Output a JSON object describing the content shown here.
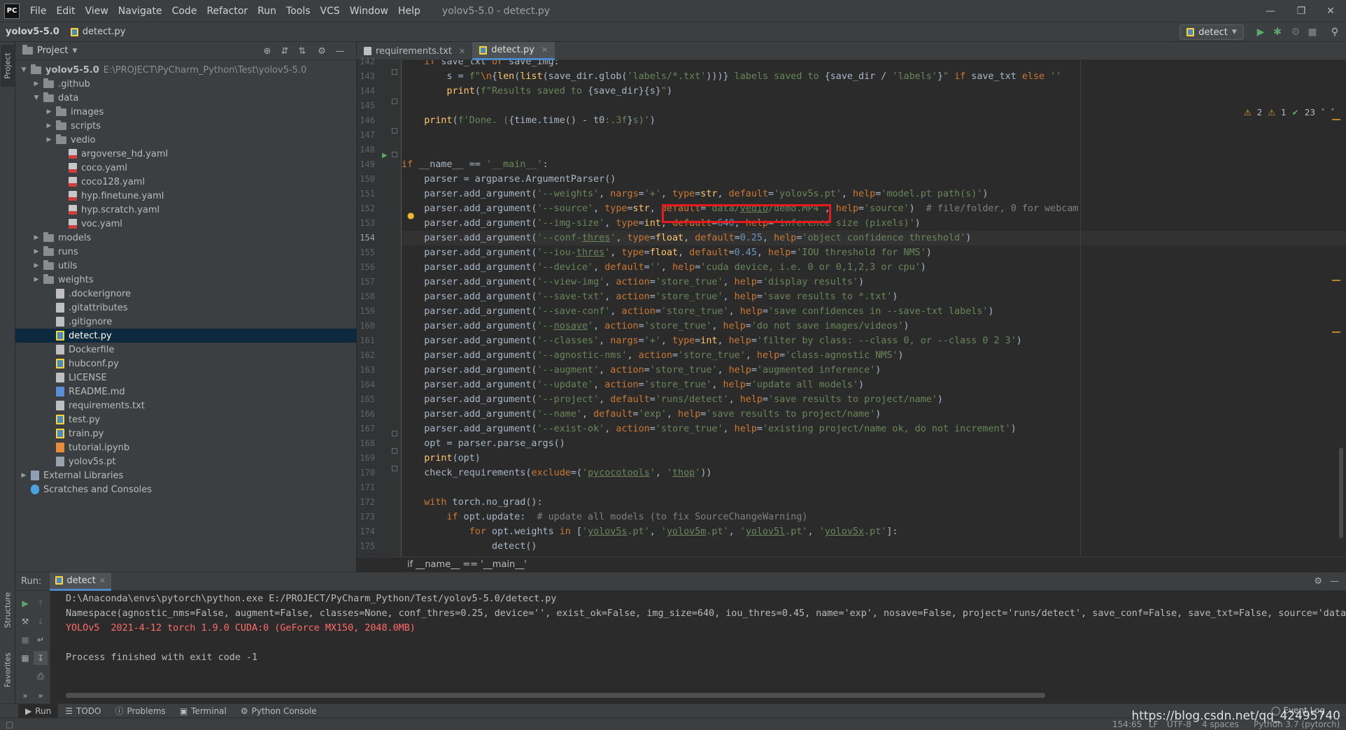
{
  "menubar": {
    "logo": "PC",
    "items": [
      "File",
      "Edit",
      "View",
      "Navigate",
      "Code",
      "Refactor",
      "Run",
      "Tools",
      "VCS",
      "Window",
      "Help"
    ],
    "title": "yolov5-5.0 - detect.py"
  },
  "navbar": {
    "project": "yolov5-5.0",
    "file": "detect.py",
    "run_config": "detect"
  },
  "project_panel": {
    "title": "Project",
    "tree": [
      {
        "label": "yolov5-5.0",
        "extra": "E:\\PROJECT\\PyCharm_Python\\Test\\yolov5-5.0",
        "bold": true,
        "depth": 0,
        "kind": "folder",
        "expanded": true
      },
      {
        "label": ".github",
        "depth": 1,
        "kind": "folder",
        "expanded": false
      },
      {
        "label": "data",
        "depth": 1,
        "kind": "folder",
        "expanded": true
      },
      {
        "label": "images",
        "depth": 2,
        "kind": "folder",
        "expanded": false
      },
      {
        "label": "scripts",
        "depth": 2,
        "kind": "folder",
        "expanded": false
      },
      {
        "label": "vedio",
        "depth": 2,
        "kind": "folder",
        "expanded": false
      },
      {
        "label": "argoverse_hd.yaml",
        "depth": 3,
        "kind": "yaml"
      },
      {
        "label": "coco.yaml",
        "depth": 3,
        "kind": "yaml"
      },
      {
        "label": "coco128.yaml",
        "depth": 3,
        "kind": "yaml"
      },
      {
        "label": "hyp.finetune.yaml",
        "depth": 3,
        "kind": "yaml"
      },
      {
        "label": "hyp.scratch.yaml",
        "depth": 3,
        "kind": "yaml"
      },
      {
        "label": "voc.yaml",
        "depth": 3,
        "kind": "yaml"
      },
      {
        "label": "models",
        "depth": 1,
        "kind": "folder",
        "expanded": false
      },
      {
        "label": "runs",
        "depth": 1,
        "kind": "folder",
        "expanded": false
      },
      {
        "label": "utils",
        "depth": 1,
        "kind": "folder",
        "expanded": false
      },
      {
        "label": "weights",
        "depth": 1,
        "kind": "folder",
        "expanded": false
      },
      {
        "label": ".dockerignore",
        "depth": 2,
        "kind": "txt"
      },
      {
        "label": ".gitattributes",
        "depth": 2,
        "kind": "txt"
      },
      {
        "label": ".gitignore",
        "depth": 2,
        "kind": "txt"
      },
      {
        "label": "detect.py",
        "depth": 2,
        "kind": "py",
        "selected": true
      },
      {
        "label": "Dockerfile",
        "depth": 2,
        "kind": "txt"
      },
      {
        "label": "hubconf.py",
        "depth": 2,
        "kind": "py"
      },
      {
        "label": "LICENSE",
        "depth": 2,
        "kind": "txt"
      },
      {
        "label": "README.md",
        "depth": 2,
        "kind": "md"
      },
      {
        "label": "requirements.txt",
        "depth": 2,
        "kind": "txt"
      },
      {
        "label": "test.py",
        "depth": 2,
        "kind": "py"
      },
      {
        "label": "train.py",
        "depth": 2,
        "kind": "py"
      },
      {
        "label": "tutorial.ipynb",
        "depth": 2,
        "kind": "nb"
      },
      {
        "label": "yolov5s.pt",
        "depth": 2,
        "kind": "pt"
      },
      {
        "label": "External Libraries",
        "depth": 0,
        "kind": "lib",
        "expanded": false
      },
      {
        "label": "Scratches and Consoles",
        "depth": 0,
        "kind": "scratch"
      }
    ]
  },
  "editor": {
    "tabs": [
      {
        "label": "requirements.txt",
        "active": false
      },
      {
        "label": "detect.py",
        "active": true
      }
    ],
    "inspections": {
      "warnings": "2",
      "weak": "1",
      "ok": "23"
    },
    "current_line": 154,
    "lines": [
      {
        "n": 142,
        "h": "    <span class=\"kw\">if</span> save_txt <span class=\"kw\">or</span> save_img:"
      },
      {
        "n": 143,
        "h": "        s = <span class=\"st\">f\"</span><span class=\"kw\">\\n</span>{<span class=\"fn\">len</span>(<span class=\"fn\">list</span>(save_dir.glob(<span class=\"st\">'labels/*.txt'</span>)))}<span class=\"st\"> labels saved to </span>{save_dir / <span class=\"st\">'labels'</span>}<span class=\"st\">\"</span> <span class=\"kw\">if</span> save_txt <span class=\"kw\">else</span> <span class=\"st\">''</span>"
      },
      {
        "n": 144,
        "h": "        <span class=\"fn\">print</span>(<span class=\"st\">f\"Results saved to </span>{save_dir}{s}<span class=\"st\">\"</span>)"
      },
      {
        "n": 145,
        "h": ""
      },
      {
        "n": 146,
        "h": "    <span class=\"fn\">print</span>(<span class=\"st\">f'Done. (</span>{time.time() - t0<span class=\"st\">:.3f</span>}<span class=\"st\">s)'</span>)"
      },
      {
        "n": 147,
        "h": ""
      },
      {
        "n": 148,
        "h": ""
      },
      {
        "n": 149,
        "h": "<span class=\"kw\">if</span> __name__ == <span class=\"st\">'__main__'</span>:"
      },
      {
        "n": 150,
        "h": "    parser = argparse.ArgumentParser()"
      },
      {
        "n": 151,
        "h": "    parser.add_argument(<span class=\"st\">'--weights'</span>, <span class=\"kw\">nargs</span>=<span class=\"st\">'+'</span>, <span class=\"kw\">type</span>=<span class=\"fn\">str</span>, <span class=\"kw\">default</span>=<span class=\"st\">'yolov5s.pt'</span>, <span class=\"kw\">help</span>=<span class=\"st\">'model.pt path(s)'</span>)"
      },
      {
        "n": 152,
        "h": "    parser.add_argument(<span class=\"st\">'--source'</span>, <span class=\"kw\">type</span>=<span class=\"fn\">str</span>, <span class=\"kw\">default</span>=<span class=\"st\">'data/<span class=\"ul\">vedio</span>/demo.MP4'</span>, <span class=\"kw\">help</span>=<span class=\"st\">'source'</span>)  <span class=\"cm\"># file/folder, 0 for webcam</span>"
      },
      {
        "n": 153,
        "h": "    parser.add_argument(<span class=\"st\">'--img-size'</span>, <span class=\"kw\">type</span>=<span class=\"fn\">int</span>, <span class=\"kw\">default</span>=<span class=\"num\">640</span>, <span class=\"kw\">help</span>=<span class=\"st\">'inference size (pixels)'</span>)"
      },
      {
        "n": 154,
        "h": "    parser.add_argument(<span class=\"st\">'--conf-<span class=\"ul\">thres</span>'</span>, <span class=\"kw\">type</span>=<span class=\"fn\">float</span>, <span class=\"kw\">default</span>=<span class=\"num\">0.25</span>, <span class=\"kw\">help</span>=<span class=\"st\">'object confidence threshold'</span>)"
      },
      {
        "n": 155,
        "h": "    parser.add_argument(<span class=\"st\">'--iou-<span class=\"ul\">thres</span>'</span>, <span class=\"kw\">type</span>=<span class=\"fn\">float</span>, <span class=\"kw\">default</span>=<span class=\"num\">0.45</span>, <span class=\"kw\">help</span>=<span class=\"st\">'IOU threshold for NMS'</span>)"
      },
      {
        "n": 156,
        "h": "    parser.add_argument(<span class=\"st\">'--device'</span>, <span class=\"kw\">default</span>=<span class=\"st\">''</span>, <span class=\"kw\">help</span>=<span class=\"st\">'cuda device, i.e. 0 or 0,1,2,3 or cpu'</span>)"
      },
      {
        "n": 157,
        "h": "    parser.add_argument(<span class=\"st\">'--view-img'</span>, <span class=\"kw\">action</span>=<span class=\"st\">'store_true'</span>, <span class=\"kw\">help</span>=<span class=\"st\">'display results'</span>)"
      },
      {
        "n": 158,
        "h": "    parser.add_argument(<span class=\"st\">'--save-txt'</span>, <span class=\"kw\">action</span>=<span class=\"st\">'store_true'</span>, <span class=\"kw\">help</span>=<span class=\"st\">'save results to *.txt'</span>)"
      },
      {
        "n": 159,
        "h": "    parser.add_argument(<span class=\"st\">'--save-conf'</span>, <span class=\"kw\">action</span>=<span class=\"st\">'store_true'</span>, <span class=\"kw\">help</span>=<span class=\"st\">'save confidences in --save-txt labels'</span>)"
      },
      {
        "n": 160,
        "h": "    parser.add_argument(<span class=\"st\">'--<span class=\"ul\">nosave</span>'</span>, <span class=\"kw\">action</span>=<span class=\"st\">'store_true'</span>, <span class=\"kw\">help</span>=<span class=\"st\">'do not save images/videos'</span>)"
      },
      {
        "n": 161,
        "h": "    parser.add_argument(<span class=\"st\">'--classes'</span>, <span class=\"kw\">nargs</span>=<span class=\"st\">'+'</span>, <span class=\"kw\">type</span>=<span class=\"fn\">int</span>, <span class=\"kw\">help</span>=<span class=\"st\">'filter by class: --class 0, or --class 0 2 3'</span>)"
      },
      {
        "n": 162,
        "h": "    parser.add_argument(<span class=\"st\">'--agnostic-nms'</span>, <span class=\"kw\">action</span>=<span class=\"st\">'store_true'</span>, <span class=\"kw\">help</span>=<span class=\"st\">'class-agnostic NMS'</span>)"
      },
      {
        "n": 163,
        "h": "    parser.add_argument(<span class=\"st\">'--augment'</span>, <span class=\"kw\">action</span>=<span class=\"st\">'store_true'</span>, <span class=\"kw\">help</span>=<span class=\"st\">'augmented inference'</span>)"
      },
      {
        "n": 164,
        "h": "    parser.add_argument(<span class=\"st\">'--update'</span>, <span class=\"kw\">action</span>=<span class=\"st\">'store_true'</span>, <span class=\"kw\">help</span>=<span class=\"st\">'update all models'</span>)"
      },
      {
        "n": 165,
        "h": "    parser.add_argument(<span class=\"st\">'--project'</span>, <span class=\"kw\">default</span>=<span class=\"st\">'runs/detect'</span>, <span class=\"kw\">help</span>=<span class=\"st\">'save results to project/name'</span>)"
      },
      {
        "n": 166,
        "h": "    parser.add_argument(<span class=\"st\">'--name'</span>, <span class=\"kw\">default</span>=<span class=\"st\">'exp'</span>, <span class=\"kw\">help</span>=<span class=\"st\">'save results to project/name'</span>)"
      },
      {
        "n": 167,
        "h": "    parser.add_argument(<span class=\"st\">'--exist-ok'</span>, <span class=\"kw\">action</span>=<span class=\"st\">'store_true'</span>, <span class=\"kw\">help</span>=<span class=\"st\">'existing project/name ok, do not increment'</span>)"
      },
      {
        "n": 168,
        "h": "    opt = parser.parse_args()"
      },
      {
        "n": 169,
        "h": "    <span class=\"fn\">print</span>(opt)"
      },
      {
        "n": 170,
        "h": "    check_requirements(<span class=\"kw\">exclude</span>=(<span class=\"st\">'<span class=\"ul\">pycocotools</span>'</span>, <span class=\"st\">'<span class=\"ul\">thop</span>'</span>))"
      },
      {
        "n": 171,
        "h": ""
      },
      {
        "n": 172,
        "h": "    <span class=\"kw\">with</span> torch.no_grad():"
      },
      {
        "n": 173,
        "h": "        <span class=\"kw\">if</span> opt.update:  <span class=\"cm\"># update all models (to fix SourceChangeWarning)</span>"
      },
      {
        "n": 174,
        "h": "            <span class=\"kw\">for</span> opt.weights <span class=\"kw\">in</span> [<span class=\"st\">'<span class=\"ul\">yolov5s</span>.pt'</span>, <span class=\"st\">'<span class=\"ul\">yolov5m</span>.pt'</span>, <span class=\"st\">'<span class=\"ul\">yolov5l</span>.pt'</span>, <span class=\"st\">'<span class=\"ul\">yolov5x</span>.pt'</span>]:"
      },
      {
        "n": 175,
        "h": "                detect()"
      }
    ],
    "breadcrumb": "if __name__ == '__main__'"
  },
  "run_panel": {
    "label": "Run:",
    "tab": "detect",
    "lines": [
      {
        "text": "D:\\Anaconda\\envs\\pytorch\\python.exe E:/PROJECT/PyCharm_Python/Test/yolov5-5.0/detect.py",
        "err": false
      },
      {
        "text": "Namespace(agnostic_nms=False, augment=False, classes=None, conf_thres=0.25, device='', exist_ok=False, img_size=640, iou_thres=0.45, name='exp', nosave=False, project='runs/detect', save_conf=False, save_txt=False, source='data/v",
        "err": false
      },
      {
        "text": "YOLOv5  2021-4-12 torch 1.9.0 CUDA:0 (GeForce MX150, 2048.0MB)",
        "err": true
      },
      {
        "text": "",
        "err": false
      },
      {
        "text": "Process finished with exit code -1",
        "err": false
      }
    ]
  },
  "side_tabs": {
    "project": "Project",
    "structure": "Structure",
    "favorites": "Favorites"
  },
  "bottom_tabs": [
    "Run",
    "TODO",
    "Problems",
    "Terminal",
    "Python Console"
  ],
  "status": {
    "position": "154:65",
    "line_sep": "LF",
    "encoding": "UTF-8",
    "indent": "4 spaces",
    "interpreter": "Python 3.7 (pytorch)",
    "event_log": "Event Log"
  },
  "watermark": "https://blog.csdn.net/qq_42495740",
  "colors": {
    "accent": "#4a88c7",
    "highlight_box": "#e8191d",
    "selection": "#0d293e",
    "error_text": "#ff6b68"
  }
}
